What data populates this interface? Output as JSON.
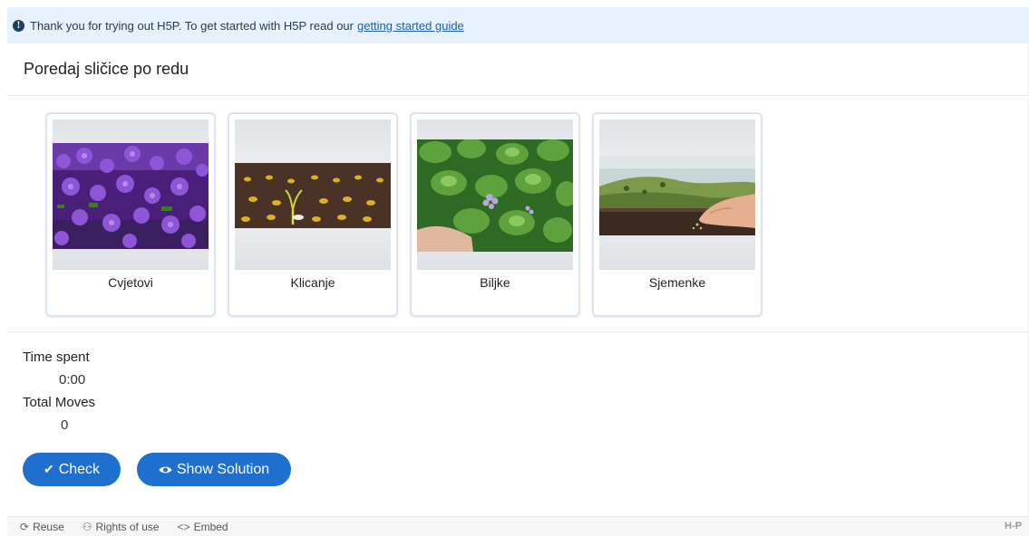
{
  "notice": {
    "icon": "info-icon",
    "text": "Thank you for trying out H5P. To get started with H5P read our",
    "link_text": "getting started guide"
  },
  "task": {
    "title": "Poredaj sličice po redu"
  },
  "cards": [
    {
      "label": "Cvjetovi"
    },
    {
      "label": "Klicanje"
    },
    {
      "label": "Biljke"
    },
    {
      "label": "Sjemenke"
    }
  ],
  "stats": {
    "time_label": "Time spent",
    "time_value": "0:00",
    "moves_label": "Total Moves",
    "moves_value": "0"
  },
  "buttons": {
    "check_label": "Check",
    "check_icon": "check-icon",
    "solution_label": "Show Solution",
    "solution_icon": "eye-icon"
  },
  "footer": {
    "reuse_label": "Reuse",
    "rights_label": "Rights of use",
    "embed_label": "Embed",
    "logo": "H-P"
  },
  "colors": {
    "accent": "#1f6fcf",
    "notice_bg": "#e7f1fb",
    "link": "#1a5eb1"
  }
}
